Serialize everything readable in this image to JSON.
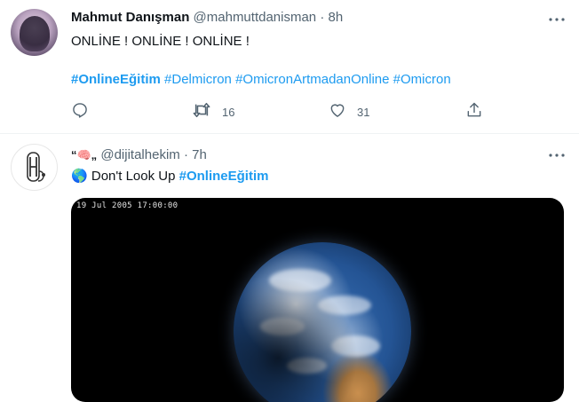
{
  "tweets": [
    {
      "author_name": "Mahmut Danışman",
      "handle": "@mahmuttdanisman",
      "separator": "·",
      "time": "8h",
      "text_line1": "ONLİNE ! ONLİNE ! ONLİNE !",
      "hashtags": [
        "#OnlineEğitim",
        "#Delmicron",
        "#OmicronArtmadanOnline",
        "#Omicron"
      ],
      "reply_icon": "reply-icon",
      "retweet_count": "16",
      "like_count": "31",
      "share_icon": "share-icon"
    },
    {
      "author_name_emoji": "“🧠„",
      "handle": "@dijitalhekim",
      "separator": "·",
      "time": "7h",
      "text_emoji": "🌎",
      "text": "Don't Look Up",
      "hashtag": "#OnlineEğitim",
      "media_timestamp": "19 Jul 2005 17:00:00"
    }
  ],
  "colors": {
    "link": "#1d9bf0",
    "muted": "#536471",
    "text": "#0f1419",
    "divider": "#eff3f4"
  }
}
